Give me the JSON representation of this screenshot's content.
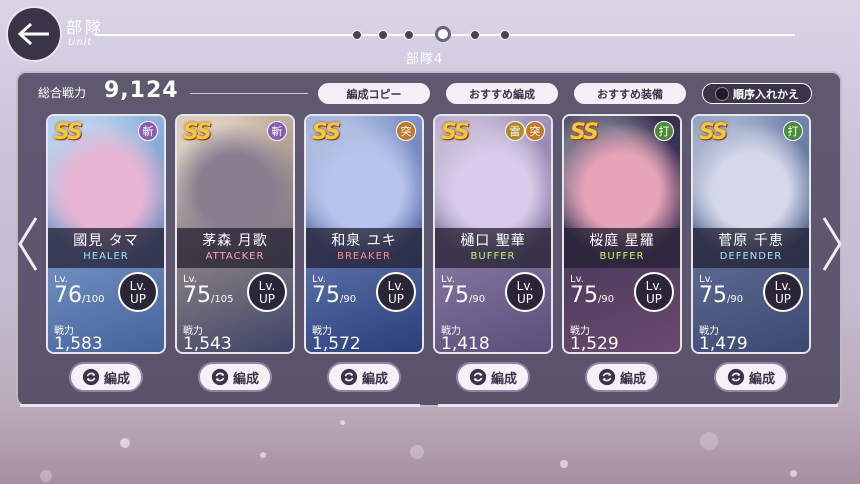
{
  "header": {
    "title": "部隊",
    "subtitle": "Unit",
    "squad_label": "部隊4",
    "page_dots": 6,
    "active_dot": 3
  },
  "summary": {
    "power_label": "総合戦力",
    "power_value": "9,124"
  },
  "actions": {
    "copy": "編成コピー",
    "recommend_form": "おすすめ編成",
    "recommend_equip": "おすすめ装備",
    "reorder": "順序入れかえ"
  },
  "cards": [
    {
      "rarity": "SS",
      "tags": [
        {
          "text": "斬",
          "color": "#8a5bb0"
        }
      ],
      "name": "國見 タマ",
      "role": "HEALER",
      "role_color": "#a7e0ff",
      "lv_label": "Lv.",
      "lv": "76",
      "lv_max": "/100",
      "lvup": "Lv. UP",
      "cp_label": "戦力",
      "cp": "1,583",
      "art_colors": [
        "#9fc3ea",
        "#e9b5d4",
        "#45619b"
      ]
    },
    {
      "rarity": "SS",
      "tags": [
        {
          "text": "斬",
          "color": "#8a5bb0"
        }
      ],
      "name": "茅森 月歌",
      "role": "ATTACKER",
      "role_color": "#ff9ec4",
      "lv_label": "Lv.",
      "lv": "75",
      "lv_max": "/105",
      "lvup": "Lv. UP",
      "cp_label": "戦力",
      "cp": "1,543",
      "art_colors": [
        "#d9c2a6",
        "#8a7d8f",
        "#3e4466"
      ]
    },
    {
      "rarity": "SS",
      "tags": [
        {
          "text": "突",
          "color": "#c07a2a"
        }
      ],
      "name": "和泉 ユキ",
      "role": "BREAKER",
      "role_color": "#ff8a8a",
      "lv_label": "Lv.",
      "lv": "75",
      "lv_max": "/90",
      "lvup": "Lv. UP",
      "cp_label": "戦力",
      "cp": "1,572",
      "art_colors": [
        "#8ea3d8",
        "#b8c4ee",
        "#2a3f7a"
      ]
    },
    {
      "rarity": "SS",
      "tags": [
        {
          "text": "雷",
          "color": "#b08a2a"
        },
        {
          "text": "突",
          "color": "#c07a2a"
        }
      ],
      "name": "樋口 聖華",
      "role": "BUFFER",
      "role_color": "#c8f07a",
      "lv_label": "Lv.",
      "lv": "75",
      "lv_max": "/90",
      "lvup": "Lv. UP",
      "cp_label": "戦力",
      "cp": "1,418",
      "art_colors": [
        "#b09ec8",
        "#d8ccea",
        "#5a4f7a"
      ]
    },
    {
      "rarity": "SS",
      "tags": [
        {
          "text": "打",
          "color": "#4a8a3a"
        }
      ],
      "name": "桜庭 星羅",
      "role": "BUFFER",
      "role_color": "#c8f07a",
      "lv_label": "Lv.",
      "lv": "75",
      "lv_max": "/90",
      "lvup": "Lv. UP",
      "cp_label": "戦力",
      "cp": "1,529",
      "art_colors": [
        "#2e2a4a",
        "#e7a3b8",
        "#6a4a6e"
      ]
    },
    {
      "rarity": "SS",
      "tags": [
        {
          "text": "打",
          "color": "#4a8a3a"
        }
      ],
      "name": "菅原 千恵",
      "role": "DEFENDER",
      "role_color": "#a7e0ff",
      "lv_label": "Lv.",
      "lv": "75",
      "lv_max": "/90",
      "lvup": "Lv. UP",
      "cp_label": "戦力",
      "cp": "1,479",
      "art_colors": [
        "#7c8fb8",
        "#d4d8ea",
        "#3c4870"
      ]
    }
  ],
  "form_button_label": "編成"
}
